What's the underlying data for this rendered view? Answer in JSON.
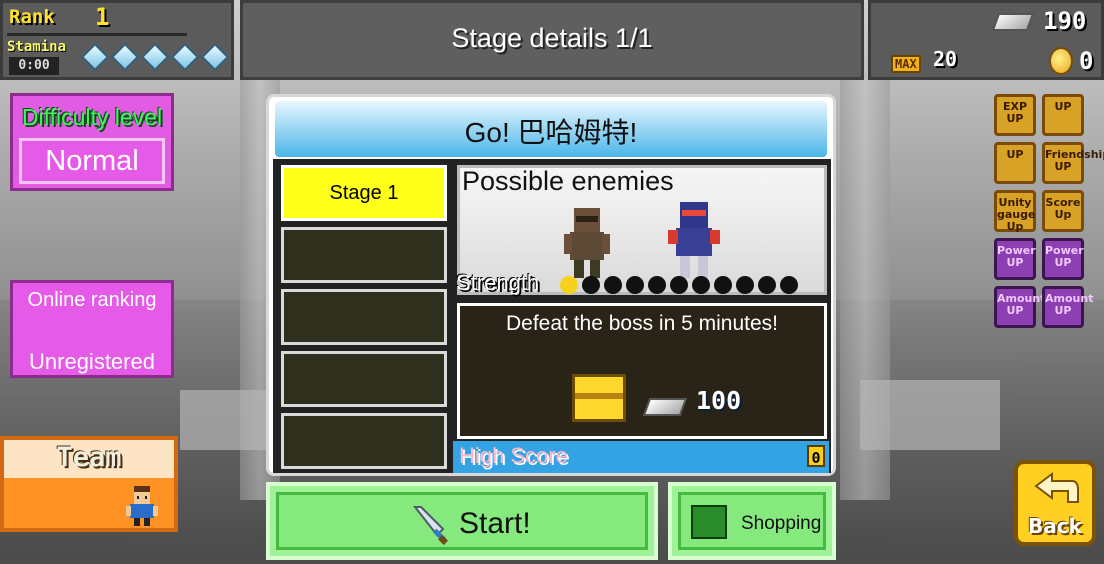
{
  "status": {
    "rank_label": "Rank",
    "rank_value": "1",
    "stamina_label": "Stamina",
    "stamina_timer": "0:00",
    "stamina_diamonds": 5,
    "silver": "190",
    "max_label": "MAX",
    "max_value": "20",
    "coins": "0"
  },
  "header": {
    "title": "Stage details   1/1"
  },
  "left_panel": {
    "difficulty_label": "Difficulty level",
    "difficulty_value": "Normal",
    "online_label": "Online ranking",
    "online_status": "Unregistered",
    "team_label": "Team"
  },
  "dialog": {
    "title": "Go! 巴哈姆特!",
    "stages": [
      {
        "label": "Stage 1",
        "active": true
      },
      {
        "label": "",
        "active": false
      },
      {
        "label": "",
        "active": false
      },
      {
        "label": "",
        "active": false
      },
      {
        "label": "",
        "active": false
      }
    ],
    "enemies_title": "Possible enemies",
    "strength_label": "Strength",
    "strength_level": 1,
    "strength_max": 11,
    "mission_text": "Defeat the boss in 5 minutes!",
    "reward_amount": "100",
    "high_score_label": "High Score",
    "high_score_value": "0"
  },
  "actions": {
    "start_label": "Start!",
    "shopping_label": "Shopping",
    "back_label": "Back"
  },
  "boosts": [
    {
      "label": "EXP UP",
      "style": "gold"
    },
    {
      "label": "UP",
      "style": "gold"
    },
    {
      "label": "UP",
      "style": "gold"
    },
    {
      "label": "Friendship UP",
      "style": "gold"
    },
    {
      "label": "Unity gauge Up",
      "style": "gold"
    },
    {
      "label": "Score Up",
      "style": "gold"
    },
    {
      "label": "Power UP",
      "style": "purple"
    },
    {
      "label": "Power UP",
      "style": "purple"
    },
    {
      "label": "Amount UP",
      "style": "purple"
    },
    {
      "label": "Amount UP",
      "style": "purple"
    }
  ],
  "colors": {
    "accent_magenta": "#e55ae6",
    "stage_active": "#ffff1a",
    "button_green": "#86e97e",
    "header_blue": "#4bb6e9"
  }
}
